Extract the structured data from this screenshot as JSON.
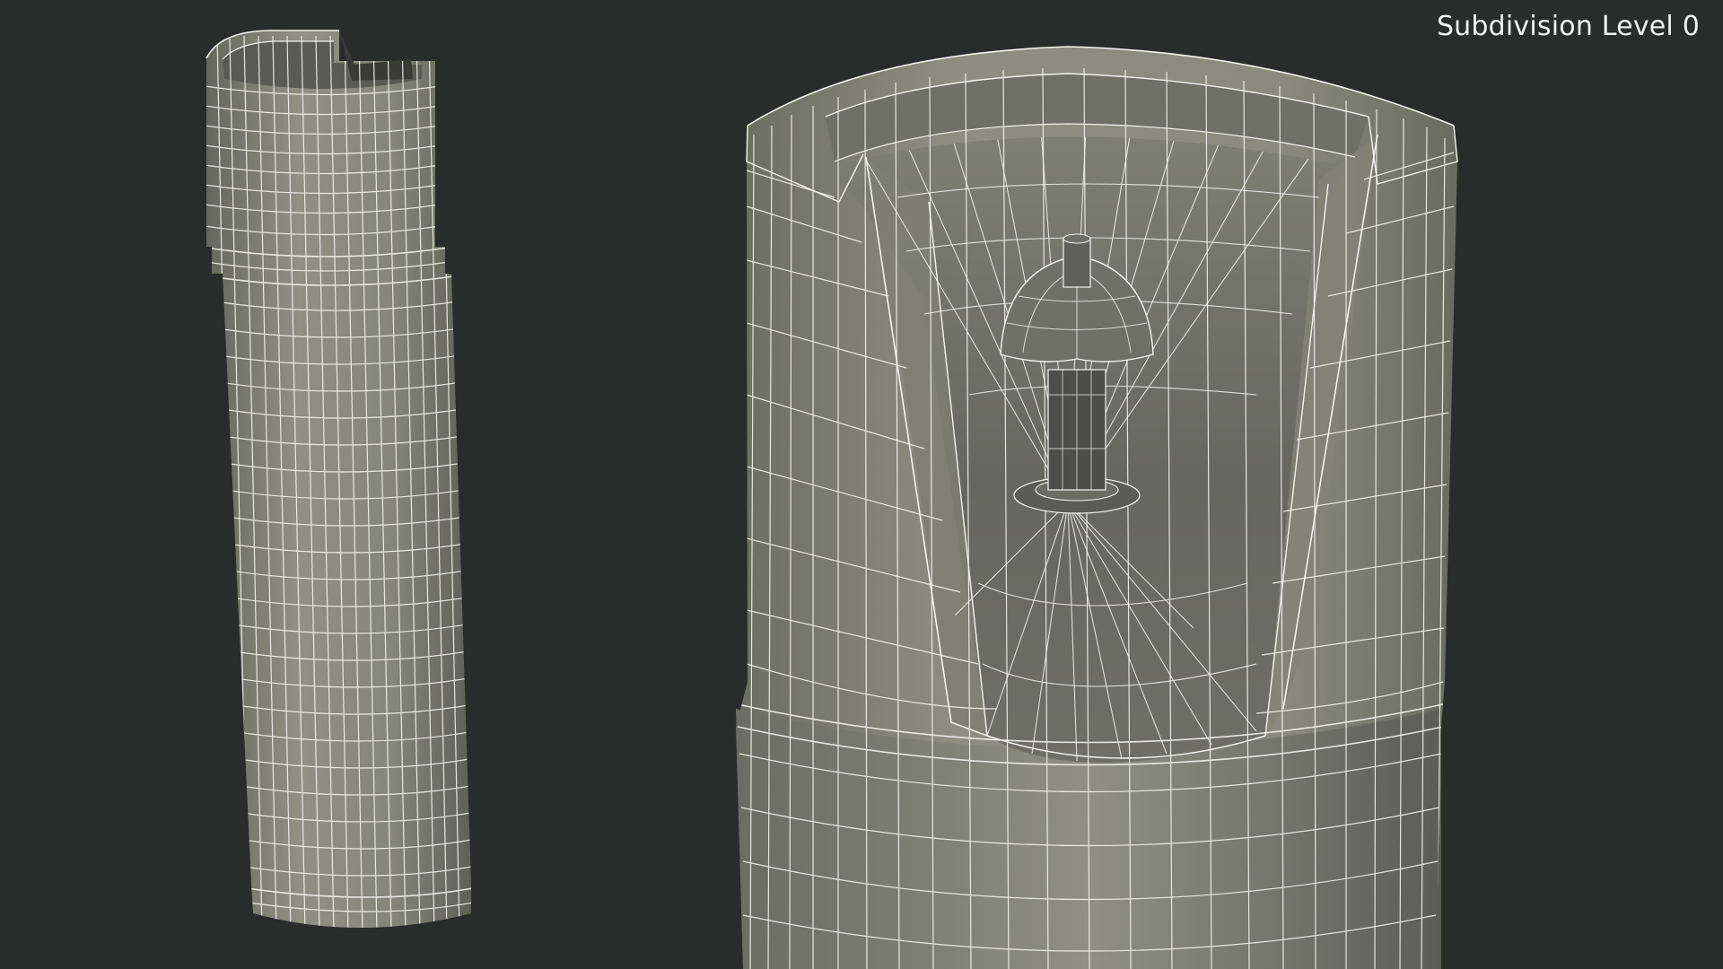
{
  "overlay": {
    "subdivision_label": "Subdivision Level 0"
  },
  "colors": {
    "background": "#2a2b2b",
    "surface_light": "#8e8e80",
    "surface_mid": "#7a7a6d",
    "surface_dark": "#5d5e55",
    "wire": "#f4f4ee",
    "caption_text": "#f2f2f2"
  }
}
